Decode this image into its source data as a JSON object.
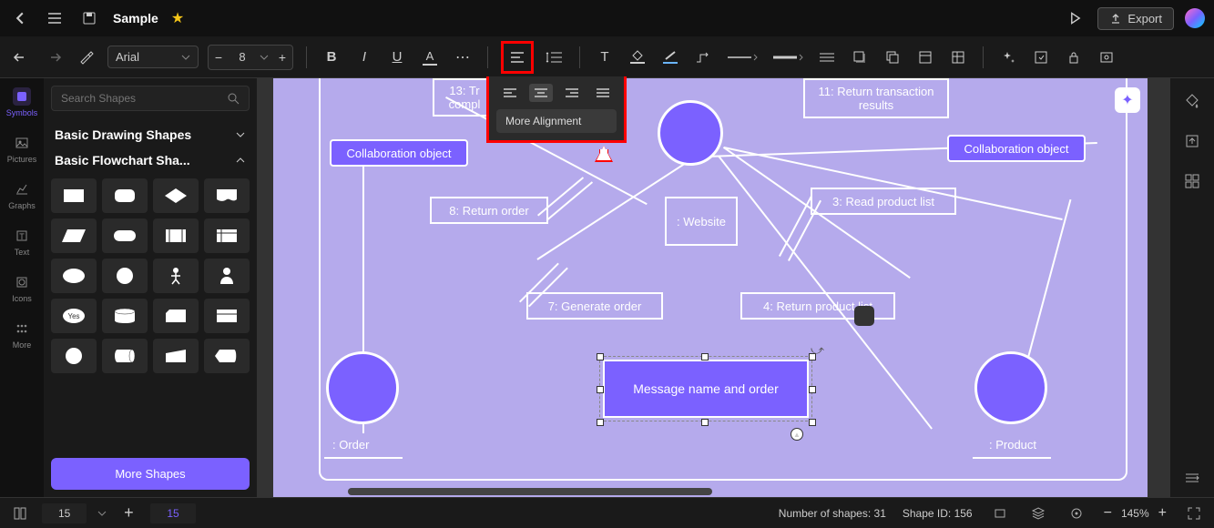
{
  "topbar": {
    "title": "Sample",
    "export_label": "Export"
  },
  "toolbar": {
    "font_family": "Arial",
    "font_size": "8",
    "more_alignment": "More Alignment"
  },
  "sidebar_rail": {
    "symbols": "Symbols",
    "pictures": "Pictures",
    "graphs": "Graphs",
    "text": "Text",
    "icons": "Icons",
    "more": "More"
  },
  "shapes_panel": {
    "search_placeholder": "Search Shapes",
    "cat_basic_drawing": "Basic Drawing Shapes",
    "cat_basic_flowchart": "Basic Flowchart Sha...",
    "more_shapes": "More Shapes"
  },
  "canvas": {
    "collab_obj_left": "Collaboration object",
    "collab_obj_right": "Collaboration object",
    "node_13": "13: Tr\ncompl",
    "node_11": "11: Return transaction results",
    "node_8": "8: Return order",
    "node_website": ": Website",
    "node_3": "3: Read product list",
    "node_7": "7: Generate order",
    "node_4": "4: Return product list",
    "node_msg": "Message name and order",
    "label_order": ": Order",
    "label_product": ": Product",
    "yes_label": "Yes"
  },
  "statusbar": {
    "page_current": "15",
    "page_new": "15",
    "shapes_count": "Number of shapes: 31",
    "shape_id": "Shape ID: 156",
    "zoom": "145%"
  }
}
